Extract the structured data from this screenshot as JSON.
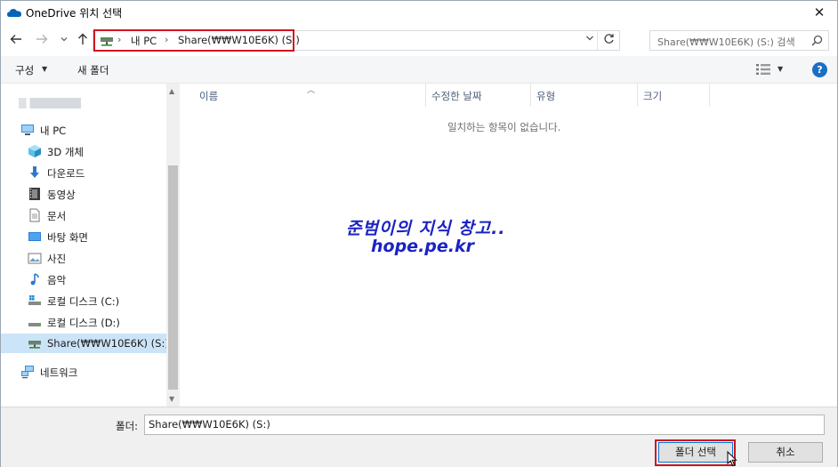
{
  "title": "OneDrive 위치 선택",
  "address": {
    "crumbs": [
      "내 PC",
      "Share(₩₩W10E6K) (S:)"
    ],
    "search_placeholder": "Share(₩₩W10E6K) (S:) 검색"
  },
  "toolbar": {
    "organize_label": "구성",
    "new_folder_label": "새 폴더"
  },
  "nav": {
    "items": [
      {
        "label": "내 PC"
      },
      {
        "label": "3D 개체"
      },
      {
        "label": "다운로드"
      },
      {
        "label": "동영상"
      },
      {
        "label": "문서"
      },
      {
        "label": "바탕 화면"
      },
      {
        "label": "사진"
      },
      {
        "label": "음악"
      },
      {
        "label": "로컬 디스크 (C:)"
      },
      {
        "label": "로컬 디스크 (D:)"
      },
      {
        "label": "Share(₩₩W10E6K) (S:)"
      },
      {
        "label": "네트워크"
      }
    ],
    "selected": "Share(₩₩W10E6K) (S:)"
  },
  "content": {
    "columns": [
      "이름",
      "수정한 날짜",
      "유형",
      "크기"
    ],
    "empty_message": "일치하는 항목이 없습니다.",
    "watermark_line1": "준범이의 지식 창고..",
    "watermark_line2": "hope.pe.kr"
  },
  "footer": {
    "folder_label": "폴더:",
    "folder_value": "Share(₩₩W10E6K) (S:)",
    "select_button": "폴더 선택",
    "cancel_button": "취소"
  },
  "colors": {
    "accent": "#0078d7",
    "highlight_box": "#d0141f",
    "selected_nav_bg": "#cce4f7",
    "watermark": "#1b22c4"
  }
}
